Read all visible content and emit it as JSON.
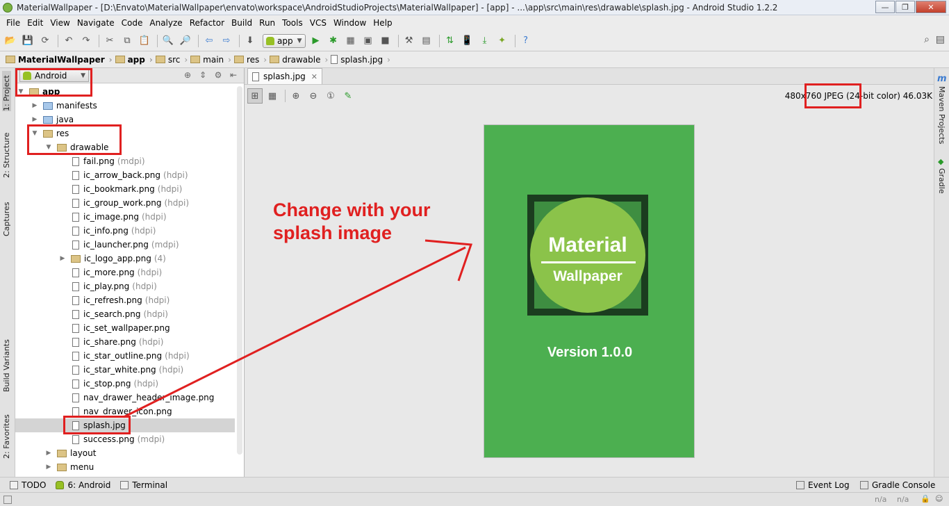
{
  "window": {
    "title": "MaterialWallpaper - [D:\\Envato\\MaterialWallpaper\\envato\\workspace\\AndroidStudioProjects\\MaterialWallpaper] - [app] - ...\\app\\src\\main\\res\\drawable\\splash.jpg - Android Studio 1.2.2",
    "minimize": "—",
    "maximize": "❐",
    "close": "✕"
  },
  "menu": [
    "File",
    "Edit",
    "View",
    "Navigate",
    "Code",
    "Analyze",
    "Refactor",
    "Build",
    "Run",
    "Tools",
    "VCS",
    "Window",
    "Help"
  ],
  "toolbar": {
    "run_config": "app",
    "icons": [
      "open-icon",
      "save-icon",
      "sync-icon",
      "undo-icon",
      "redo-icon",
      "cut-icon",
      "copy-icon",
      "paste-icon",
      "find-icon",
      "replace-icon",
      "back-icon",
      "forward-icon",
      "make-icon",
      "run-icon",
      "debug-icon",
      "coverage-icon",
      "attach-icon",
      "stop-icon",
      "project-structure-icon",
      "sdk-manager-icon",
      "avd-manager-icon",
      "sync-gradle-icon",
      "monitor-icon",
      "help-icon"
    ]
  },
  "breadcrumb": [
    "MaterialWallpaper",
    "app",
    "src",
    "main",
    "res",
    "drawable",
    "splash.jpg"
  ],
  "left_tool_tabs": [
    "1: Project",
    "2: Structure",
    "Captures",
    "Build Variants",
    "2: Favorites"
  ],
  "right_tool_tabs": [
    "Maven Projects",
    "Gradle"
  ],
  "project_panel": {
    "view_mode": "Android",
    "tree": [
      {
        "label": "app",
        "qualifier": "",
        "kind": "module",
        "expanded": true
      },
      {
        "label": "manifests",
        "qualifier": "",
        "kind": "folder-blue",
        "expanded": false
      },
      {
        "label": "java",
        "qualifier": "",
        "kind": "folder-blue",
        "expanded": false
      },
      {
        "label": "res",
        "qualifier": "",
        "kind": "folder",
        "expanded": true
      },
      {
        "label": "drawable",
        "qualifier": "",
        "kind": "folder",
        "expanded": true
      },
      {
        "label": "fail.png",
        "qualifier": "(mdpi)",
        "kind": "file"
      },
      {
        "label": "ic_arrow_back.png",
        "qualifier": "(hdpi)",
        "kind": "file"
      },
      {
        "label": "ic_bookmark.png",
        "qualifier": "(hdpi)",
        "kind": "file"
      },
      {
        "label": "ic_group_work.png",
        "qualifier": "(hdpi)",
        "kind": "file"
      },
      {
        "label": "ic_image.png",
        "qualifier": "(hdpi)",
        "kind": "file"
      },
      {
        "label": "ic_info.png",
        "qualifier": "(hdpi)",
        "kind": "file"
      },
      {
        "label": "ic_launcher.png",
        "qualifier": "(mdpi)",
        "kind": "file"
      },
      {
        "label": "ic_logo_app.png",
        "qualifier": "(4)",
        "kind": "folder",
        "expanded": false
      },
      {
        "label": "ic_more.png",
        "qualifier": "(hdpi)",
        "kind": "file"
      },
      {
        "label": "ic_play.png",
        "qualifier": "(hdpi)",
        "kind": "file"
      },
      {
        "label": "ic_refresh.png",
        "qualifier": "(hdpi)",
        "kind": "file"
      },
      {
        "label": "ic_search.png",
        "qualifier": "(hdpi)",
        "kind": "file"
      },
      {
        "label": "ic_set_wallpaper.png",
        "qualifier": "",
        "kind": "file"
      },
      {
        "label": "ic_share.png",
        "qualifier": "(hdpi)",
        "kind": "file"
      },
      {
        "label": "ic_star_outline.png",
        "qualifier": "(hdpi)",
        "kind": "file"
      },
      {
        "label": "ic_star_white.png",
        "qualifier": "(hdpi)",
        "kind": "file"
      },
      {
        "label": "ic_stop.png",
        "qualifier": "(hdpi)",
        "kind": "file"
      },
      {
        "label": "nav_drawer_header_image.png",
        "qualifier": "",
        "kind": "file"
      },
      {
        "label": "nav_drawer_icon.png",
        "qualifier": "",
        "kind": "file"
      },
      {
        "label": "splash.jpg",
        "qualifier": "",
        "kind": "file",
        "selected": true
      },
      {
        "label": "success.png",
        "qualifier": "(mdpi)",
        "kind": "file"
      },
      {
        "label": "layout",
        "qualifier": "",
        "kind": "folder",
        "expanded": false
      },
      {
        "label": "menu",
        "qualifier": "",
        "kind": "folder",
        "expanded": false
      }
    ]
  },
  "editor": {
    "tab_label": "splash.jpg",
    "image_size": "480x760 JPEG",
    "image_color": "(24-bit color) 46.03K",
    "splash": {
      "title": "Material",
      "subtitle": "Wallpaper",
      "version": "Version 1.0.0"
    }
  },
  "annotation": {
    "line1": "Change with your",
    "line2": "splash image"
  },
  "bottom_tabs": [
    "TODO",
    "6: Android",
    "Terminal"
  ],
  "bottom_right_tabs": [
    "Event Log",
    "Gradle Console"
  ],
  "status": {
    "na1": "n/a",
    "na2": "n/a"
  },
  "colors": {
    "splash_bg": "#4caf50",
    "logo_circle": "#8bc34a",
    "annotation_red": "#e02020"
  }
}
